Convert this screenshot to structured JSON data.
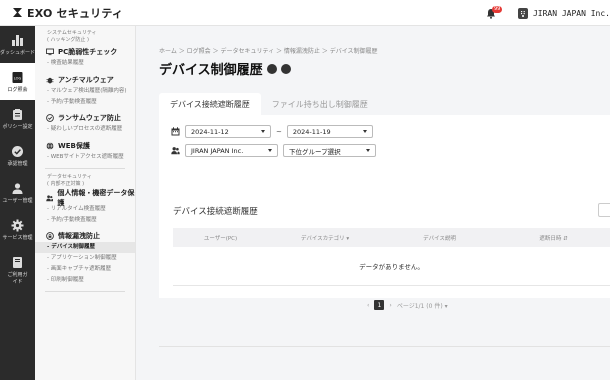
{
  "header": {
    "brand": "EXO セキュリティ",
    "notification_count": "99",
    "company": "JIRAN JAPAN Inc."
  },
  "rail": [
    {
      "label": "ダッシュボード",
      "icon": "bar-chart-icon"
    },
    {
      "label": "ログ照会",
      "icon": "log-icon",
      "active": true
    },
    {
      "label": "ポリシー設定",
      "icon": "clipboard-icon"
    },
    {
      "label": "承認管理",
      "icon": "check-circle-icon"
    },
    {
      "label": "ユーザー管理",
      "icon": "users-icon"
    },
    {
      "label": "サービス管理",
      "icon": "gear-icon"
    },
    {
      "label": "ご利用ガイド",
      "icon": "book-icon"
    }
  ],
  "submenu": {
    "system_label_1": "システムセキュリティ",
    "system_label_2": "( ハッキング防止 )",
    "pc_check": "PC脆弱性チェック",
    "pc_check_sub": "- 検査結果履歴",
    "antimalware": "アンチマルウェア",
    "antimalware_sub1": "- マルウェア検出履歴(隔離内容)",
    "antimalware_sub2": "- 予約/手動検査履歴",
    "ransom": "ランサムウェア防止",
    "ransom_sub": "- 疑わしいプロセスの遮断履歴",
    "web": "WEB保護",
    "web_sub": "- WEBサイトアクセス遮断履歴",
    "data_label_1": "データセキュリティ",
    "data_label_2": "( 内部不正対策 )",
    "personal": "個人情報・機密データ保護",
    "personal_sub1": "- リアルタイム検査履歴",
    "personal_sub2": "- 予約/手動検査履歴",
    "leak": "情報漏洩防止",
    "leak_sub1": "- デバイス制御履歴",
    "leak_sub2": "- アプリケーション制御履歴",
    "leak_sub3": "- 画面キャプチャ遮断履歴",
    "leak_sub4": "- 印刷制御履歴"
  },
  "main": {
    "breadcrumb": "ホーム ＞ ログ照会 ＞ データセキュリティ ＞ 情報漏洩防止 ＞ デバイス制御履歴",
    "title": "デバイス制御履歴",
    "tabs": [
      "デバイス接続遮断履歴",
      "ファイル持ち出し制御履歴"
    ],
    "date_from": "2024-11-12",
    "date_to": "2024-11-19",
    "date_sep": "~",
    "company_select": "JIRAN JAPAN Inc.",
    "group_select": "下位グループ選択",
    "section_title": "デバイス接続遮断履歴",
    "columns": [
      "ユーザー(PC)",
      "デバイスカテゴリ ▾",
      "デバイス説明",
      "遮断日時 ⇵"
    ],
    "empty_message": "データがありません。",
    "pager_current": "1",
    "pager_info": "ページ1/1 (0 件) ▾",
    "pager_prev": "‹",
    "pager_next": "›"
  }
}
